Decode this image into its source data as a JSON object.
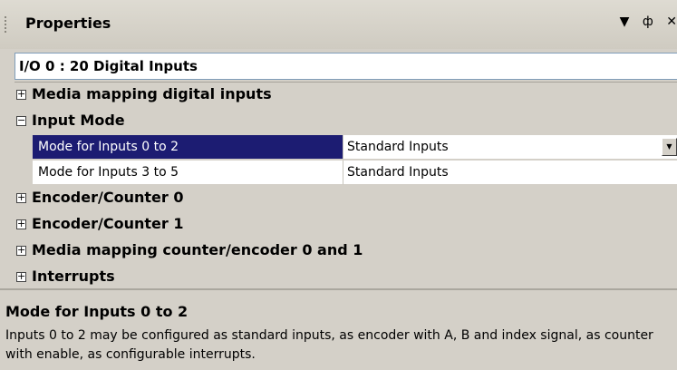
{
  "panel": {
    "title": "Properties",
    "dropdown_icon": "▼",
    "pin_icon": "ф",
    "close_icon": "✕"
  },
  "object_selector": {
    "value": "I/O 0 : 20 Digital Inputs"
  },
  "grid": {
    "rows": [
      {
        "type": "category",
        "toggle": "+",
        "label": "Media mapping digital inputs"
      },
      {
        "type": "category",
        "toggle": "−",
        "label": "Input Mode"
      },
      {
        "type": "property",
        "name": "Mode for Inputs 0 to 2",
        "value": "Standard Inputs",
        "selected": true
      },
      {
        "type": "property",
        "name": "Mode for Inputs 3 to 5",
        "value": "Standard Inputs",
        "selected": false
      },
      {
        "type": "category",
        "toggle": "+",
        "label": "Encoder/Counter 0"
      },
      {
        "type": "category",
        "toggle": "+",
        "label": "Encoder/Counter 1"
      },
      {
        "type": "category",
        "toggle": "+",
        "label": "Media mapping counter/encoder 0 and 1"
      },
      {
        "type": "category",
        "toggle": "+",
        "label": "Interrupts"
      }
    ]
  },
  "description": {
    "title": "Mode for Inputs 0 to 2",
    "text": "Inputs 0 to 2 may be configured as standard inputs, as encoder with A, B and index signal, as counter with enable, as configurable interrupts."
  }
}
